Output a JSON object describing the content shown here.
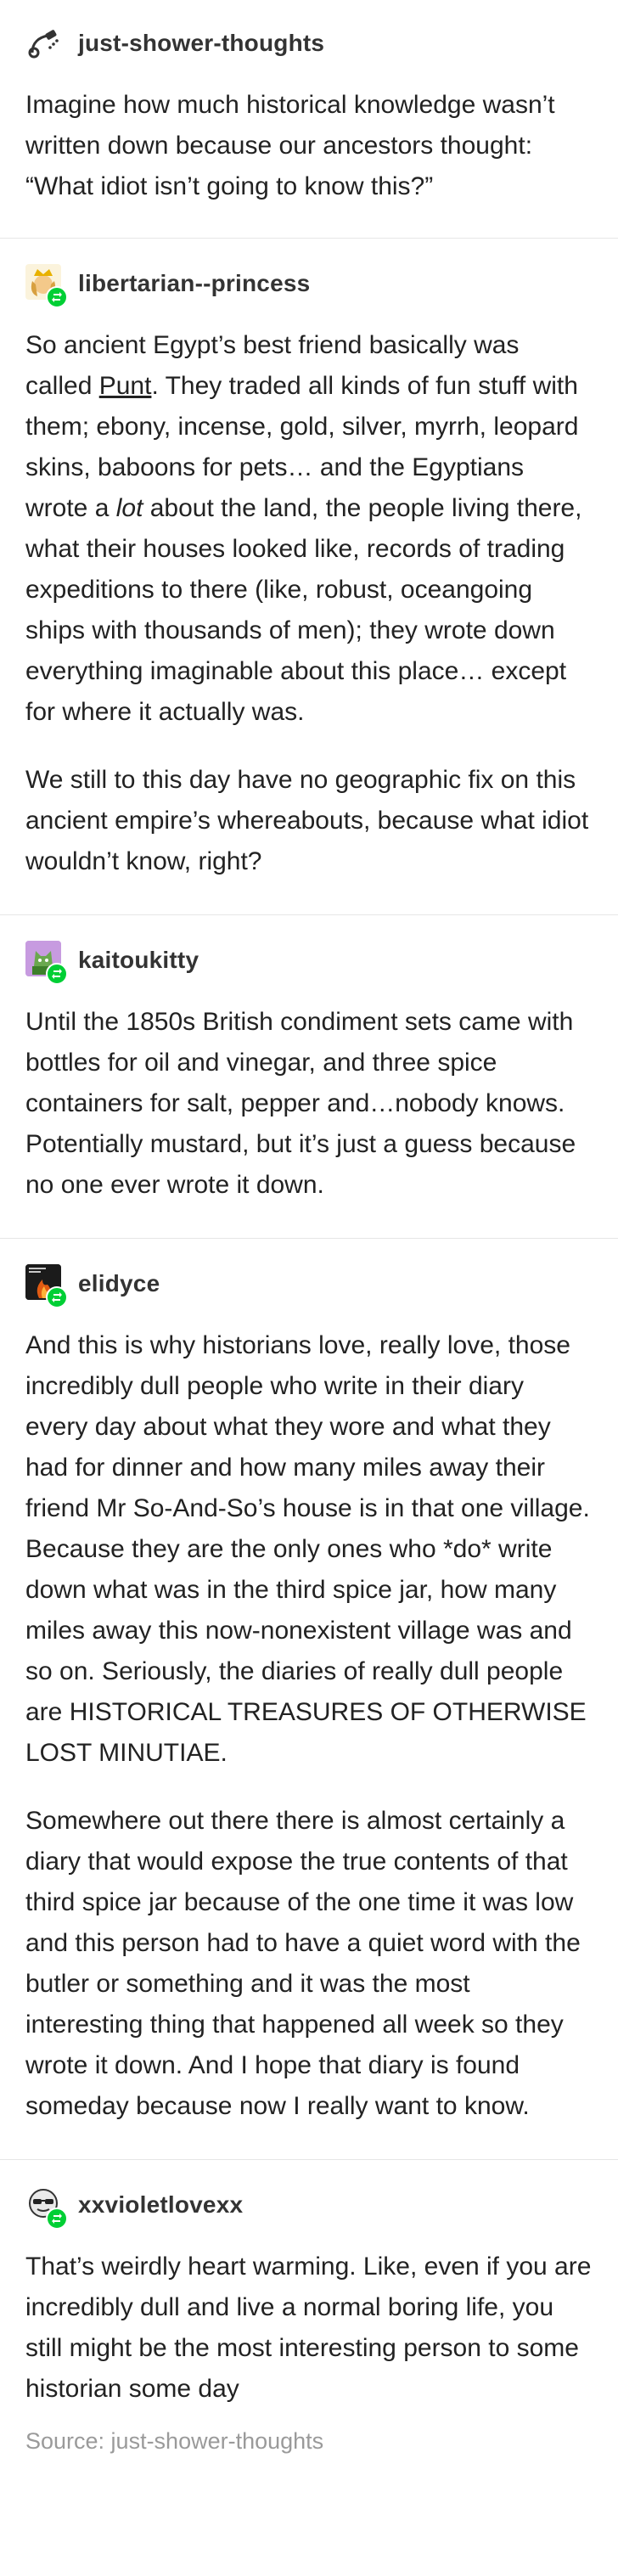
{
  "posts": [
    {
      "username": "just-shower-thoughts",
      "avatar_icon": "shower-head-icon",
      "reblog": false,
      "paragraphs": [
        "Imagine how much historical knowledge wasn’t written down because our ancestors thought: “What idiot isn’t going to know this?”"
      ]
    },
    {
      "username": "libertarian--princess",
      "avatar_icon": "crown-avatar-icon",
      "reblog": true,
      "para1": {
        "part1": "So ancient Egypt’s best friend basically was called ",
        "link": "Punt",
        "part2": ". They traded all kinds of fun stuff with them; ebony, incense, gold, silver, myrrh, leopard skins, baboons for pets… and the Egyptians wrote a ",
        "em": "lot",
        "part3": " about the land, the people living there, what their houses looked like, records of trading expeditions to there (like, robust, oceangoing ships with thousands of men); they wrote down everything imaginable about this place… except for where it actually was."
      },
      "para2": "We still to this day have no geographic fix on this ancient empire’s whereabouts, because what idiot wouldn’t know, right?"
    },
    {
      "username": "kaitoukitty",
      "avatar_icon": "cat-avatar-icon",
      "reblog": true,
      "paragraphs": [
        "Until the 1850s British condiment sets came with bottles for oil and vinegar, and three spice containers for salt, pepper and…nobody knows.  Potentially mustard, but it’s just a guess because no one ever wrote it down."
      ]
    },
    {
      "username": "elidyce",
      "avatar_icon": "fire-avatar-icon",
      "reblog": true,
      "paragraphs": [
        "And this is why historians love, really love, those incredibly dull people who write in their diary every day about what they wore and what they had for dinner and how many miles away their friend Mr So-And-So’s house is in that one village. Because they are the only ones who *do* write down what was in the third spice jar, how many miles away this now-nonexistent village was and so on. Seriously, the diaries of really dull people are HISTORICAL TREASURES OF OTHERWISE LOST MINUTIAE.",
        "Somewhere out there there is almost certainly a diary that would expose the true contents of that third spice jar because of the one time it was low and this person had to have a quiet word with the butler or something and it was the most interesting thing that happened all week so they wrote it down. And I hope that diary is found someday because now I really want to know."
      ]
    },
    {
      "username": "xxvioletlovexx",
      "avatar_icon": "sunglasses-avatar-icon",
      "reblog": true,
      "paragraphs": [
        "That’s weirdly heart warming. Like, even if you are incredibly dull and live a normal boring life, you still might be the most interesting person to some historian some day"
      ]
    }
  ],
  "source": "Source: just-shower-thoughts",
  "colors": {
    "reblog_badge": "#00cf35",
    "divider": "#e6e6e6",
    "source_text": "#9a9a9a"
  }
}
